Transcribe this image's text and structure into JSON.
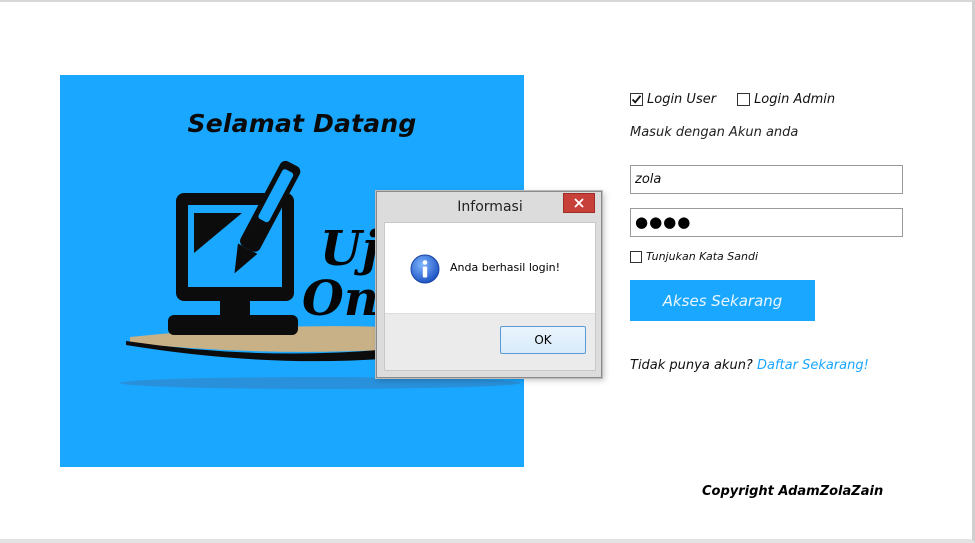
{
  "banner": {
    "title": "Selamat Datang",
    "logo_word_1": "Ujia",
    "logo_word_2": "Onli",
    "background_color": "#1aa7ff"
  },
  "login": {
    "options": [
      {
        "label": "Login User",
        "checked": true
      },
      {
        "label": "Login Admin",
        "checked": false
      }
    ],
    "subtitle": "Masuk dengan Akun anda",
    "username_value": "zola",
    "password_masked": "●●●●",
    "show_password_label": "Tunjukan Kata Sandi",
    "show_password_checked": false,
    "submit_label": "Akses Sekarang",
    "register_prompt": "Tidak punya akun?",
    "register_link": "Daftar Sekarang!",
    "accent_color": "#1aa7ff"
  },
  "copyright": "Copyright AdamZolaZain",
  "dialog": {
    "title": "Informasi",
    "icon": "info-icon",
    "message": "Anda berhasil login!",
    "ok_label": "OK"
  }
}
